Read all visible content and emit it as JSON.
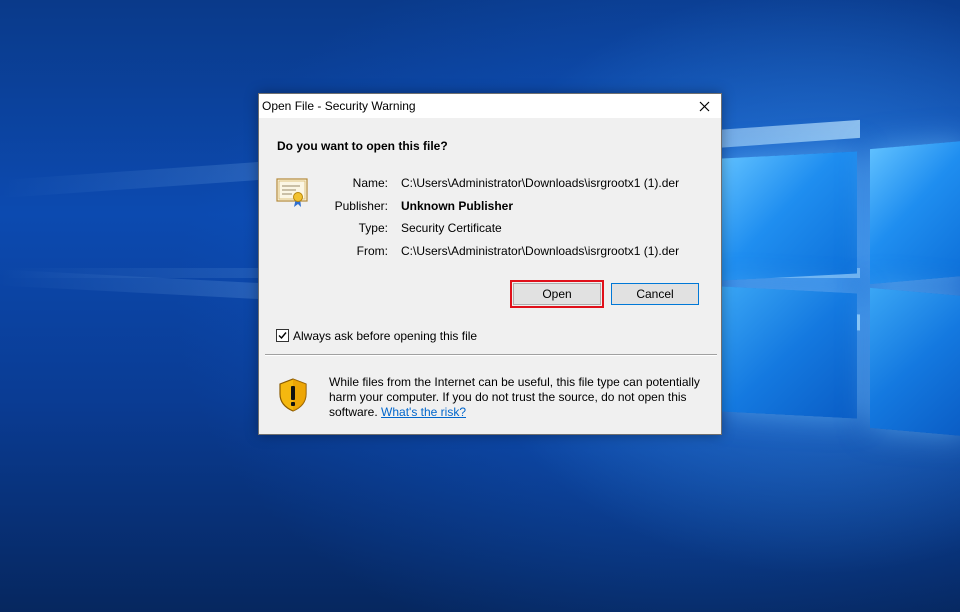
{
  "dialog": {
    "title": "Open File - Security Warning",
    "close_icon": "close-icon",
    "heading": "Do you want to open this file?",
    "file_icon": "certificate-icon",
    "fields": {
      "name_label": "Name:",
      "name_value": "C:\\Users\\Administrator\\Downloads\\isrgrootx1 (1).der",
      "publisher_label": "Publisher:",
      "publisher_value": "Unknown Publisher",
      "type_label": "Type:",
      "type_value": "Security Certificate",
      "from_label": "From:",
      "from_value": "C:\\Users\\Administrator\\Downloads\\isrgrootx1 (1).der"
    },
    "buttons": {
      "open_label": "Open",
      "cancel_label": "Cancel"
    },
    "checkbox": {
      "label": "Always ask before opening this file",
      "checked": true
    },
    "warning": {
      "icon": "shield-warning-icon",
      "text": "While files from the Internet can be useful, this file type can potentially harm your computer. If you do not trust the source, do not open this software.",
      "link_text": "What's the risk?"
    }
  },
  "colors": {
    "highlight_border": "#e0101a",
    "dialog_bg": "#f0f0f0",
    "link": "#0066cc",
    "default_button_border": "#0078d7"
  }
}
